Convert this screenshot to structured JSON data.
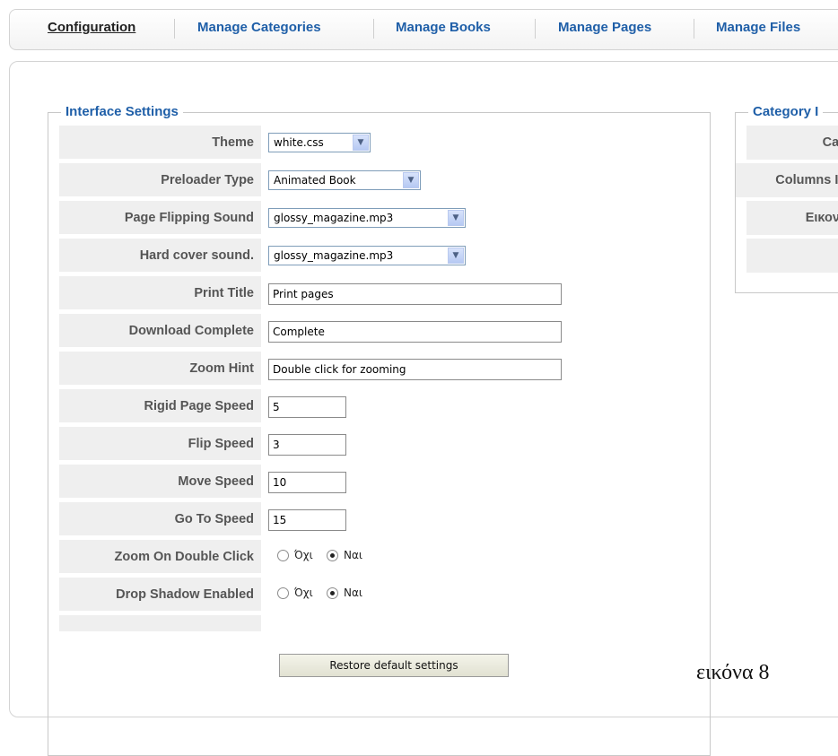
{
  "tabs": [
    {
      "label": "Configuration",
      "active": true
    },
    {
      "label": "Manage Categories",
      "active": false
    },
    {
      "label": "Manage Books",
      "active": false
    },
    {
      "label": "Manage Pages",
      "active": false
    },
    {
      "label": "Manage Files",
      "active": false
    }
  ],
  "interface": {
    "legend": "Interface Settings",
    "theme": {
      "label": "Theme",
      "value": "white.css"
    },
    "preloader": {
      "label": "Preloader Type",
      "value": "Animated Book"
    },
    "flip_sound": {
      "label": "Page Flipping Sound",
      "value": "glossy_magazine.mp3"
    },
    "hard_sound": {
      "label": "Hard cover sound.",
      "value": "glossy_magazine.mp3"
    },
    "print_title": {
      "label": "Print Title",
      "value": "Print pages"
    },
    "download": {
      "label": "Download Complete",
      "value": "Complete"
    },
    "zoom_hint": {
      "label": "Zoom Hint",
      "value": "Double click for zooming"
    },
    "rigid_speed": {
      "label": "Rigid Page Speed",
      "value": "5"
    },
    "flip_speed": {
      "label": "Flip Speed",
      "value": "3"
    },
    "move_speed": {
      "label": "Move Speed",
      "value": "10"
    },
    "goto_speed": {
      "label": "Go To Speed",
      "value": "15"
    },
    "zoom_dblclick": {
      "label": "Zoom On Double Click",
      "no": "Όχι",
      "yes": "Ναι",
      "selected": "yes"
    },
    "drop_shadow": {
      "label": "Drop Shadow Enabled",
      "no": "Όχι",
      "yes": "Ναι",
      "selected": "yes"
    },
    "restore_label": "Restore default settings"
  },
  "category": {
    "legend": "Category I",
    "rows": [
      "Cat",
      "Columns Ir",
      "Εικονί",
      ""
    ]
  },
  "caption": "εικόνα 8",
  "colors": {
    "accent": "#1f5fa8",
    "label_bg": "#efefef"
  },
  "icons": {
    "select_arrow": "chevron-down-icon"
  }
}
